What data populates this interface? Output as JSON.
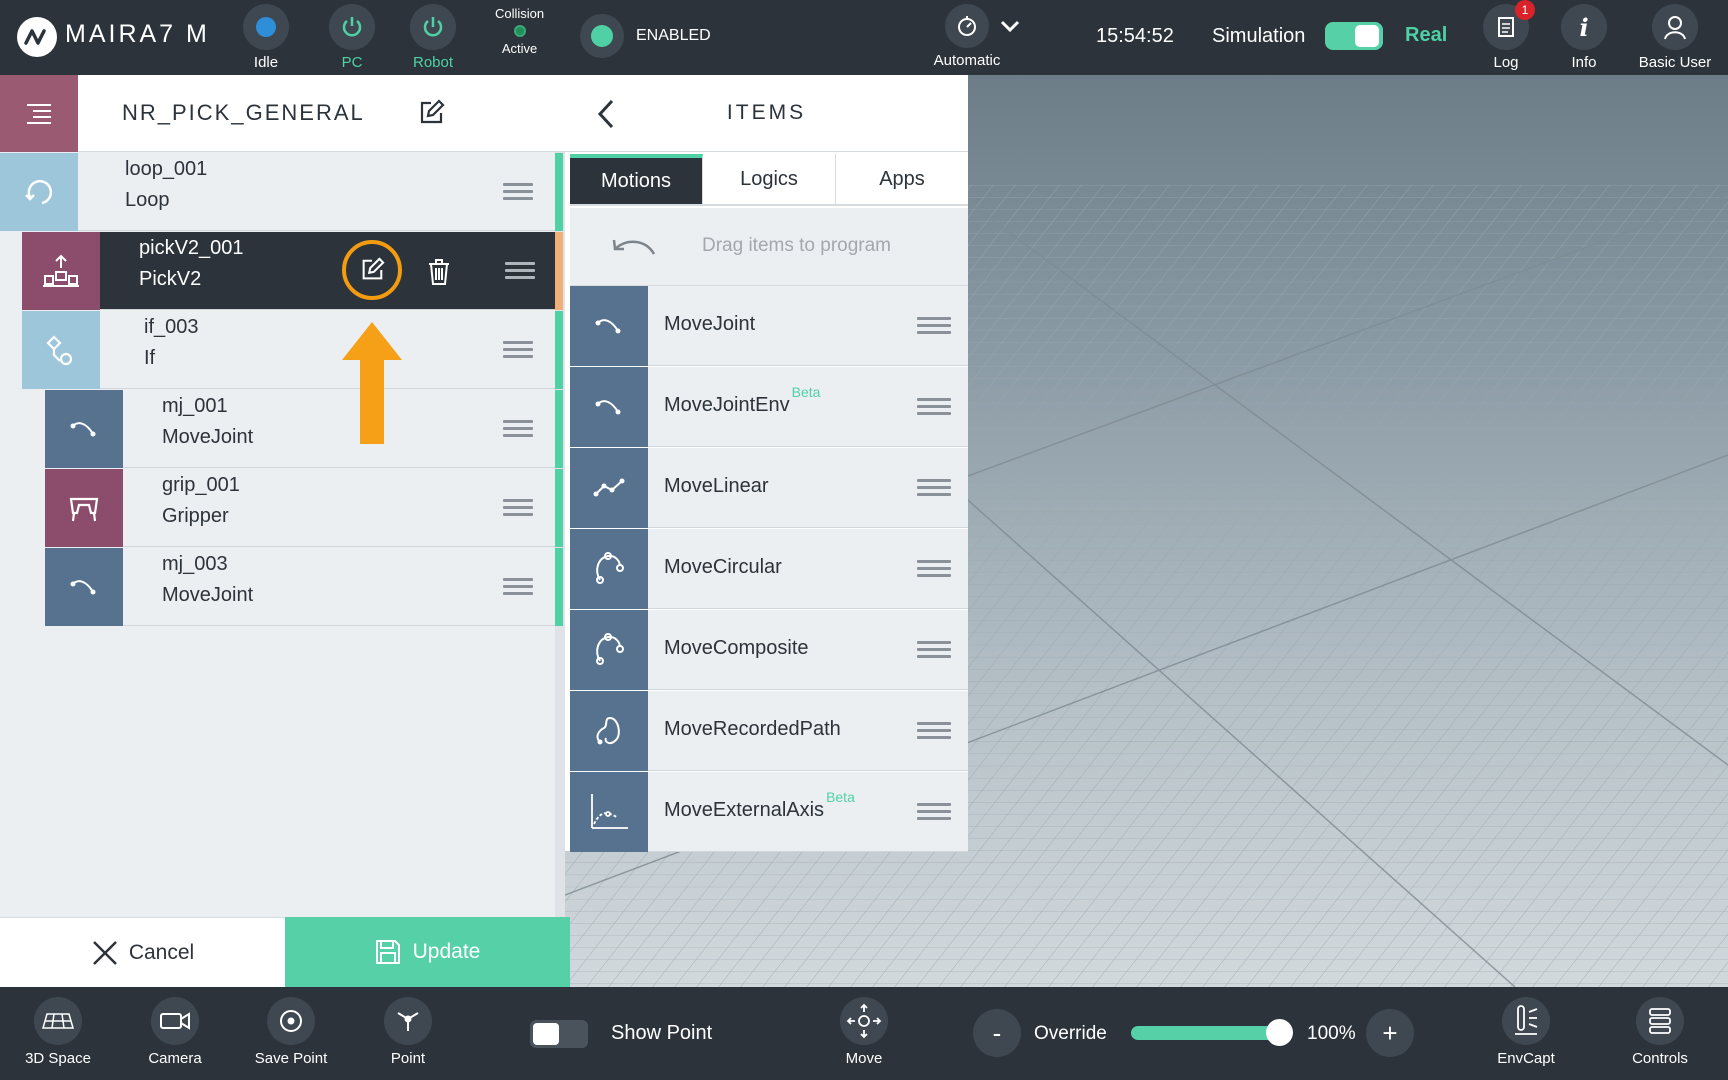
{
  "topbar": {
    "brand": "MAIRA7 M",
    "status_idle": "Idle",
    "status_pc": "PC",
    "status_robot": "Robot",
    "collision_title": "Collision",
    "collision_status": "Active",
    "enabled": "ENABLED",
    "mode": "Automatic",
    "time": "15:54:52",
    "simulation": "Simulation",
    "real": "Real",
    "log": "Log",
    "log_badge": "1",
    "info": "Info",
    "user": "Basic User"
  },
  "program": {
    "title": "NR_PICK_GENERAL",
    "rows": [
      {
        "name": "loop_001",
        "type": "Loop",
        "icon": "loop-icon",
        "color": "#9ec6da"
      },
      {
        "name": "pickV2_001",
        "type": "PickV2",
        "icon": "pick-icon",
        "color": "#8b4d6b"
      },
      {
        "name": "if_003",
        "type": "If",
        "icon": "if-icon",
        "color": "#9ec6da"
      },
      {
        "name": "mj_001",
        "type": "MoveJoint",
        "icon": "move-joint-icon",
        "color": "#56728f"
      },
      {
        "name": "grip_001",
        "type": "Gripper",
        "icon": "gripper-icon",
        "color": "#8b4d6b"
      },
      {
        "name": "mj_003",
        "type": "MoveJoint",
        "icon": "move-joint-icon",
        "color": "#56728f"
      }
    ],
    "cancel": "Cancel",
    "update": "Update"
  },
  "items": {
    "title": "ITEMS",
    "tabs": [
      "Motions",
      "Logics",
      "Apps"
    ],
    "drag_hint": "Drag items to program",
    "list": [
      {
        "label": "MoveJoint",
        "beta": ""
      },
      {
        "label": "MoveJointEnv",
        "beta": "Beta"
      },
      {
        "label": "MoveLinear",
        "beta": ""
      },
      {
        "label": "MoveCircular",
        "beta": ""
      },
      {
        "label": "MoveComposite",
        "beta": ""
      },
      {
        "label": "MoveRecordedPath",
        "beta": ""
      },
      {
        "label": "MoveExternalAxis",
        "beta": "Beta"
      }
    ]
  },
  "bottombar": {
    "space3d": "3D Space",
    "camera": "Camera",
    "save_point": "Save Point",
    "point": "Point",
    "show_point": "Show Point",
    "move": "Move",
    "override": "Override",
    "override_value": "100%",
    "minus": "-",
    "plus": "+",
    "envcapt": "EnvCapt",
    "controls": "Controls"
  },
  "colors": {
    "accent": "#4fd1a5",
    "dark": "#2c333a",
    "highlight": "#f39c12"
  }
}
